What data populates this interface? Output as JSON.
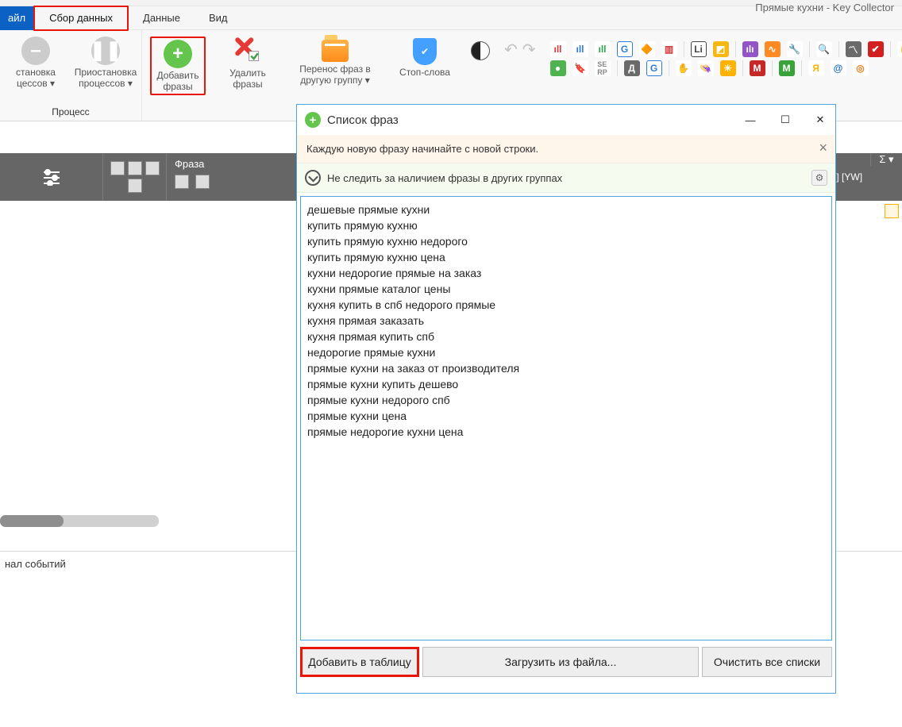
{
  "app": {
    "title": "Прямые кухни - Key Collector"
  },
  "tabs": {
    "file": "айл",
    "active": "Сбор данных",
    "data": "Данные",
    "view": "Вид"
  },
  "ribbon": {
    "process_group": "Процесс",
    "stop": "становка\nцессов ▾",
    "pause": "Приостановка\nпроцессов ▾",
    "add": "Добавить\nфразы",
    "delete": "Удалить\nфразы",
    "move": "Перенос фраз в\nдругую группу ▾",
    "stopwords": "Стоп-слова"
  },
  "grid": {
    "col_phrase": "Фраза",
    "col_ry_yw": "RY] [YW]",
    "sigma": "Σ ▾"
  },
  "journal": "нал событий",
  "modal": {
    "title": "Список фраз",
    "hint": "Каждую новую фразу начинайте с новой строки.",
    "option": "Не следить за наличием фразы в других группах",
    "phrases": "дешевые прямые кухни\nкупить прямую кухню\nкупить прямую кухню недорого\nкупить прямую кухню цена\nкухни недорогие прямые на заказ\nкухни прямые каталог цены\nкухня купить в спб недорого прямые\nкухня прямая заказать\nкухня прямая купить спб\nнедорогие прямые кухни\nпрямые кухни на заказ от производителя\nпрямые кухни купить дешево\nпрямые кухни недорого спб\nпрямые кухни цена\nпрямые недорогие кухни цена",
    "btn_add": "Добавить в таблицу",
    "btn_load": "Загрузить из файла...",
    "btn_clear": "Очистить все списки"
  }
}
